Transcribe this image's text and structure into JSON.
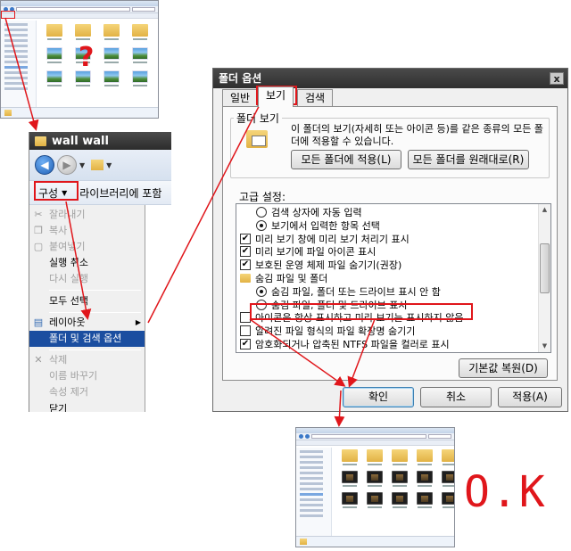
{
  "annotation": {
    "ok_label": "O.K",
    "question_mark": "?"
  },
  "wall_window": {
    "title": "wall wall",
    "toolbar": {
      "organize_label": "구성",
      "library_label": "라이브러리에 포함"
    },
    "menu": [
      {
        "label": "잘라내기",
        "state": "disabled",
        "icon": "scissors-icon"
      },
      {
        "label": "복사",
        "state": "disabled",
        "icon": "copy-icon"
      },
      {
        "label": "붙여넣기",
        "state": "disabled",
        "icon": "paste-icon"
      },
      {
        "label": "실행 취소",
        "state": "normal"
      },
      {
        "label": "다시 실행",
        "state": "disabled"
      },
      {
        "label": "모두 선택",
        "state": "normal"
      },
      {
        "label": "레이아웃",
        "state": "normal",
        "submenu": true,
        "icon": "layout-icon"
      },
      {
        "label": "폴더 및 검색 옵션",
        "state": "highlighted"
      },
      {
        "label": "삭제",
        "state": "disabled",
        "icon": "delete-icon"
      },
      {
        "label": "이름 바꾸기",
        "state": "disabled"
      },
      {
        "label": "속성 제거",
        "state": "disabled"
      },
      {
        "label": "속성",
        "state": "normal"
      },
      {
        "label": "닫기",
        "state": "normal"
      }
    ]
  },
  "folder_options": {
    "title": "폴더 옵션",
    "close_label": "x",
    "tabs": [
      "일반",
      "보기",
      "검색"
    ],
    "active_tab": "보기",
    "folder_view": {
      "group_label": "폴더 보기",
      "description": "이 폴더의 보기(자세히 또는 아이콘 등)를 같은 종류의 모든 폴더에 적용할 수 있습니다.",
      "apply_button": "모든 폴더에 적용(L)",
      "reset_button": "모든 폴더를 원래대로(R)"
    },
    "advanced": {
      "label": "고급 설정:",
      "items": [
        {
          "type": "radio",
          "checked": false,
          "label": "검색 상자에 자동 입력",
          "indent": 1
        },
        {
          "type": "radio",
          "checked": true,
          "label": "보기에서 입력한 항목 선택",
          "indent": 1
        },
        {
          "type": "checkbox",
          "checked": true,
          "label": "미리 보기 창에 미리 보기 처리기 표시",
          "indent": 0
        },
        {
          "type": "checkbox",
          "checked": true,
          "label": "미리 보기에 파일 아이콘 표시",
          "indent": 0
        },
        {
          "type": "checkbox",
          "checked": true,
          "label": "보호된 운영 체제 파일 숨기기(권장)",
          "indent": 0
        },
        {
          "type": "folder",
          "checked": false,
          "label": "숨김 파일 및 폴더",
          "indent": 0
        },
        {
          "type": "radio",
          "checked": true,
          "label": "숨김 파일, 폴더 또는 드라이브 표시 안 함",
          "indent": 1
        },
        {
          "type": "radio",
          "checked": false,
          "label": "숨김 파일, 폴더 및 드라이브 표시",
          "indent": 1
        },
        {
          "type": "checkbox",
          "checked": false,
          "label": "아이콘은 항상 표시하고 미리 보기는 표시하지 않음",
          "indent": 0
        },
        {
          "type": "checkbox",
          "checked": false,
          "label": "알려진 파일 형식의 파일 확장명 숨기기",
          "indent": 0
        },
        {
          "type": "checkbox",
          "checked": true,
          "label": "암호화되거나 압축된 NTFS 파일을 컬러로 표시",
          "indent": 0
        }
      ]
    },
    "restore_button": "기본값 복원(D)",
    "buttons": {
      "ok": "확인",
      "cancel": "취소",
      "apply": "적용(A)"
    }
  }
}
